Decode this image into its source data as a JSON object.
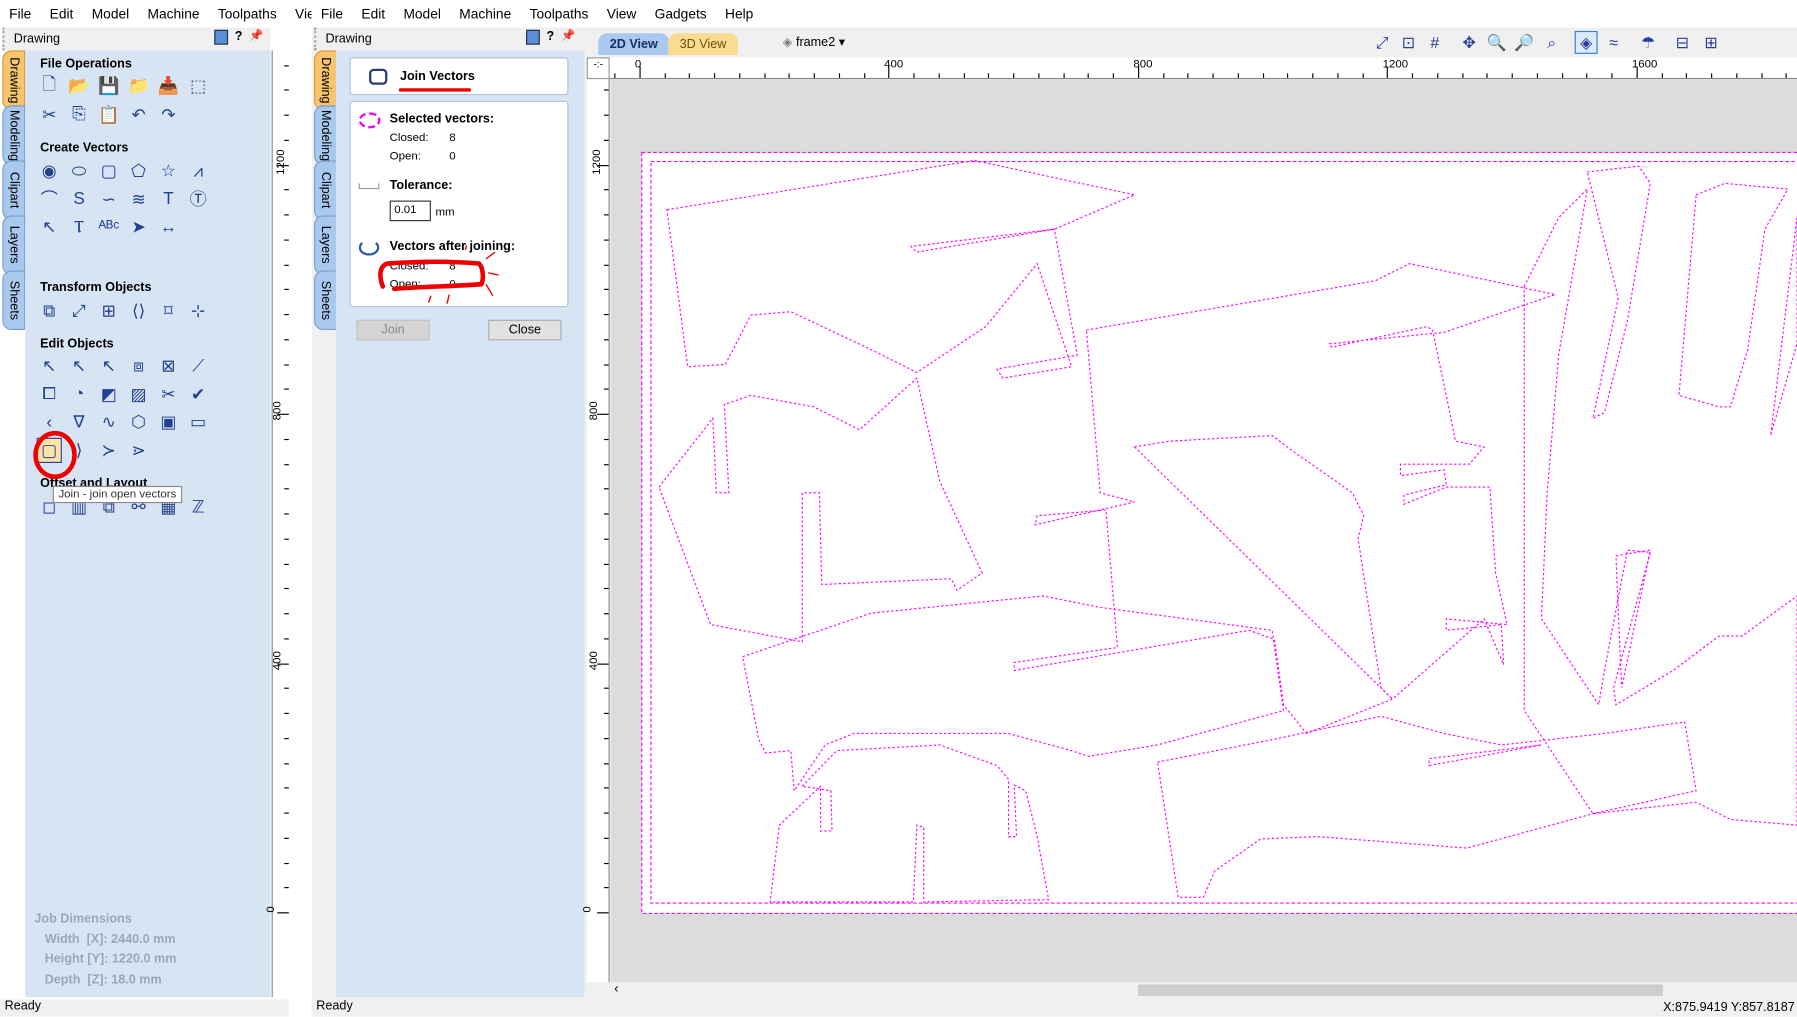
{
  "left_window": {
    "menu": [
      "File",
      "Edit",
      "Model",
      "Machine",
      "Toolpaths",
      "View"
    ],
    "dock_title": "Drawing",
    "help_label": "?",
    "side_tabs": [
      "Drawing",
      "Modeling",
      "Clipart",
      "Layers",
      "Sheets"
    ],
    "sections": {
      "file_operations": {
        "title": "File Operations",
        "icons": [
          "new-file",
          "open-file",
          "save-file",
          "open-folder",
          "import-file",
          "select-all",
          "cut",
          "copy",
          "paste",
          "undo",
          "redo"
        ]
      },
      "create_vectors": {
        "title": "Create Vectors",
        "icons": [
          "circle",
          "ellipse",
          "rectangle",
          "polygon",
          "star",
          "polyline",
          "arc",
          "curve",
          "bezier",
          "wave",
          "text",
          "text-box",
          "text-on-curve",
          "text-frame",
          "arc-text",
          "dimension-arrow",
          "dimension"
        ]
      },
      "transform_objects": {
        "title": "Transform Objects",
        "icons": [
          "move",
          "scale",
          "align",
          "mirror",
          "distort",
          "center"
        ]
      },
      "edit_objects": {
        "title": "Edit Objects",
        "icons": [
          "select",
          "node-edit",
          "transform-select",
          "group",
          "ungroup",
          "measure",
          "weld",
          "subtract",
          "intersect",
          "trim",
          "scissors",
          "check",
          "curve-fit",
          "node-triangle",
          "smooth",
          "join-closed",
          "draw-bitmap",
          "trace-bitmap",
          "join-vectors",
          "close-vectors",
          "fillet",
          "extend"
        ]
      },
      "offset_and_layout": {
        "title": "Offset and Layout",
        "icons": [
          "offset",
          "array",
          "block-copy",
          "chain",
          "nest",
          "zigzag"
        ]
      }
    },
    "tooltip": "Join - join open vectors",
    "job_dimensions": {
      "title": "Job Dimensions",
      "width": "Width  [X]: 2440.0 mm",
      "height": "Height [Y]: 1220.0 mm",
      "depth": "Depth  [Z]: 18.0 mm"
    },
    "ruler_labels": [
      "1200",
      "800",
      "400",
      "0"
    ],
    "status": "Ready"
  },
  "right_window": {
    "menu": [
      "File",
      "Edit",
      "Model",
      "Machine",
      "Toolpaths",
      "View",
      "Gadgets",
      "Help"
    ],
    "dock_title": "Drawing",
    "help_label": "?",
    "side_tabs": [
      "Drawing",
      "Modeling",
      "Clipart",
      "Layers",
      "Sheets"
    ],
    "join_panel": {
      "title": "Join Vectors",
      "selected_heading": "Selected vectors:",
      "closed_label": "Closed:",
      "closed_value": "8",
      "open_label": "Open:",
      "open_value": "0",
      "tolerance_heading": "Tolerance:",
      "tolerance_value": "0.01",
      "tolerance_unit": "mm",
      "after_heading": "Vectors after joining:",
      "after_closed_label": "Closed:",
      "after_closed_value": "8",
      "after_open_label": "Open:",
      "after_open_value": "0",
      "join_button": "Join",
      "close_button": "Close"
    },
    "view_tabs": [
      "2D View",
      "3D View"
    ],
    "active_view_tab": "2D View",
    "layer_dropdown": "frame2",
    "toolbar_icons": [
      "zoom-extents",
      "zoom-box",
      "grid",
      "pan",
      "zoom-in",
      "zoom-out",
      "zoom-selection",
      "show-vectors",
      "toggle-toolpaths",
      "material",
      "split-horizontal",
      "split-vertical"
    ],
    "ruler_top_labels": [
      "0",
      "400",
      "800",
      "1200",
      "1600"
    ],
    "ruler_left_labels": [
      "1200",
      "800",
      "400",
      "0"
    ],
    "status": "Ready",
    "cursor_position": "X:875.9419 Y:857.8187"
  },
  "colors": {
    "vector": "#ff00ff",
    "panel": "#d6e4f3",
    "active_tab": "#f6c56e",
    "annotation": "#e00000"
  }
}
